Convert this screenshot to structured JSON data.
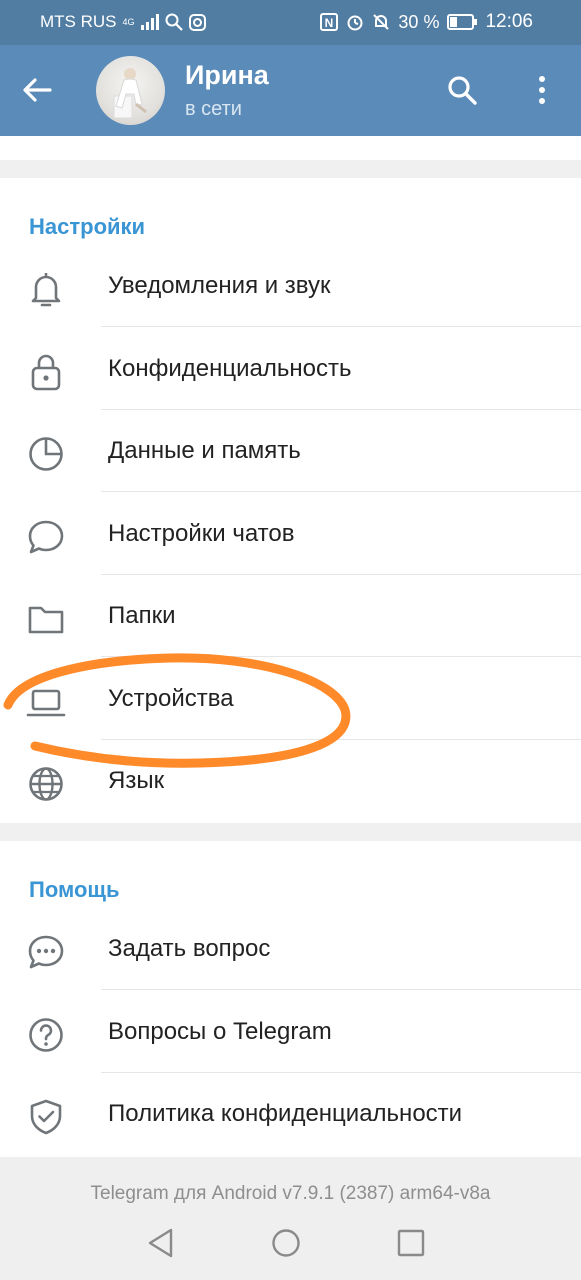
{
  "status_bar": {
    "carrier": "MTS RUS",
    "network": "4G",
    "nfc": "N",
    "battery": "30 %",
    "time": "12:06"
  },
  "app_bar": {
    "title": "Ирина",
    "subtitle": "в сети",
    "icons": [
      "back-arrow-icon",
      "search-icon",
      "more-vert-icon"
    ]
  },
  "settings": {
    "title": "Настройки",
    "items": [
      {
        "label": "Уведомления и звук",
        "icon": "bell-icon"
      },
      {
        "label": "Конфиденциальность",
        "icon": "lock-icon"
      },
      {
        "label": "Данные и память",
        "icon": "pie-chart-icon"
      },
      {
        "label": "Настройки чатов",
        "icon": "chat-bubble-icon"
      },
      {
        "label": "Папки",
        "icon": "folder-icon"
      },
      {
        "label": "Устройства",
        "icon": "laptop-icon"
      },
      {
        "label": "Язык",
        "icon": "globe-icon"
      }
    ]
  },
  "help": {
    "title": "Помощь",
    "items": [
      {
        "label": "Задать вопрос",
        "icon": "chat-dots-icon"
      },
      {
        "label": "Вопросы о Telegram",
        "icon": "question-circle-icon"
      },
      {
        "label": "Политика конфиденциальности",
        "icon": "shield-check-icon"
      }
    ]
  },
  "footer": {
    "version": "Telegram для Android v7.9.1 (2387) arm64-v8a"
  },
  "colors": {
    "header": "#5b8bb8",
    "status_bar": "#527da3",
    "section_title": "#3a95d5",
    "annotation": "#ff8a2a"
  }
}
